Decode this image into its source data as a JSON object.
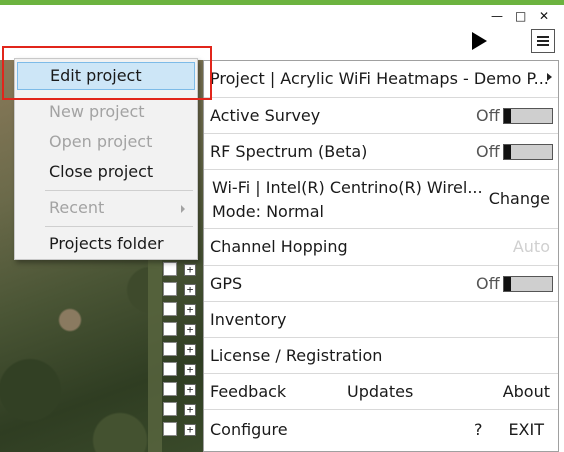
{
  "window": {
    "minimize_glyph": "—",
    "maximize_glyph": "□",
    "close_glyph": "✕"
  },
  "toolbar": {
    "play_icon": "play-icon",
    "menu_icon": "hamburger-icon"
  },
  "main_menu": {
    "project_label": "Project  |  Acrylic WiFi Heatmaps - Demo P...",
    "active_survey": {
      "label": "Active Survey",
      "state": "Off"
    },
    "rf_spectrum": {
      "label": "RF Spectrum (Beta)",
      "state": "Off"
    },
    "wifi": {
      "label": "Wi-Fi | Intel(R) Centrino(R) Wirel...",
      "mode_label": "Mode:",
      "mode_value": "Normal",
      "change_label": "Change"
    },
    "channel_hopping": {
      "label": "Channel Hopping",
      "value": "Auto"
    },
    "gps": {
      "label": "GPS",
      "state": "Off"
    },
    "inventory": "Inventory",
    "license": "License / Registration",
    "feedback": "Feedback",
    "updates": "Updates",
    "about": "About",
    "configure": "Configure",
    "help": "?",
    "exit": "EXIT"
  },
  "project_popup": {
    "items": [
      {
        "label": "Edit project",
        "enabled": true,
        "highlighted": true
      },
      {
        "label": "New project",
        "enabled": false
      },
      {
        "label": "Open project",
        "enabled": false
      },
      {
        "label": "Close project",
        "enabled": true
      },
      {
        "label": "Recent",
        "enabled": false,
        "submenu": true
      },
      {
        "label": "Projects folder",
        "enabled": true
      }
    ]
  },
  "colors": {
    "accent_top": "#6cb33f",
    "highlight": "#cde6f7",
    "annotation_box": "#e1251b"
  }
}
